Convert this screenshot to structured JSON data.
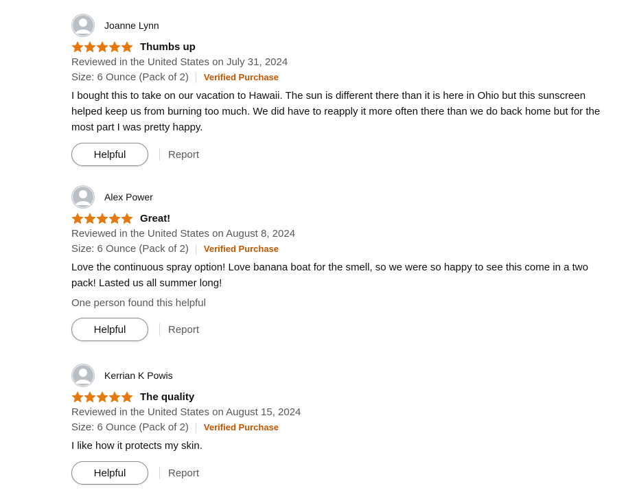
{
  "colors": {
    "star": "#e47911",
    "verified": "#c45500",
    "muted": "#565959",
    "text": "#0f1111"
  },
  "reviews": [
    {
      "reviewer": "Joanne Lynn",
      "rating": 5,
      "max_rating": 5,
      "title": "Thumbs up",
      "date": "Reviewed in the United States on July 31, 2024",
      "size": "Size: 6 Ounce (Pack of 2)",
      "verified": "Verified Purchase",
      "body": "I bought this to take on our vacation to Hawaii. The sun is different there than it is here in Ohio but this sunscreen helped keep us from burning too much. We did have to reapply it more often there than we do back home but for the most part I was pretty happy.",
      "helpful_count": "",
      "helpful_label": "Helpful",
      "report_label": "Report"
    },
    {
      "reviewer": "Alex Power",
      "rating": 5,
      "max_rating": 5,
      "title": "Great!",
      "date": "Reviewed in the United States on August 8, 2024",
      "size": "Size: 6 Ounce (Pack of 2)",
      "verified": "Verified Purchase",
      "body": "Love the continuous spray option! Love banana boat for the smell, so we were so happy to see this come in a two pack! Lasted us all summer long!",
      "helpful_count": "One person found this helpful",
      "helpful_label": "Helpful",
      "report_label": "Report"
    },
    {
      "reviewer": "Kerrian K Powis",
      "rating": 5,
      "max_rating": 5,
      "title": "The quality",
      "date": "Reviewed in the United States on August 15, 2024",
      "size": "Size: 6 Ounce (Pack of 2)",
      "verified": "Verified Purchase",
      "body": "I like how it protects my skin.",
      "helpful_count": "",
      "helpful_label": "Helpful",
      "report_label": "Report"
    }
  ]
}
